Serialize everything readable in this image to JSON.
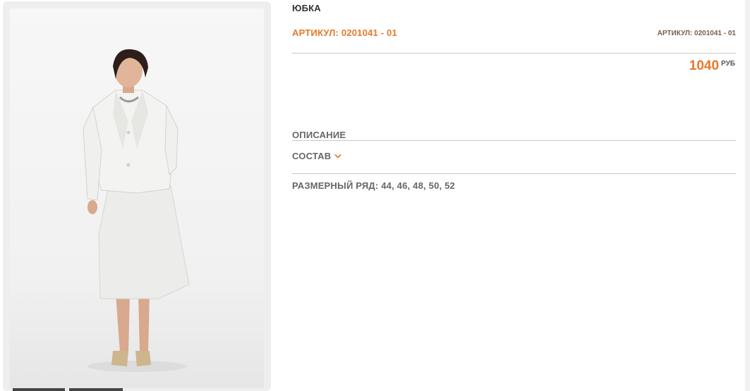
{
  "product": {
    "title": "ЮБКА",
    "sku_main": "АРТИКУЛ: 0201041 - 01",
    "sku_small": "АРТИКУЛ: 0201041 - 01",
    "price": "1040",
    "currency": "РУБ"
  },
  "sections": {
    "description": "ОПИСАНИЕ",
    "composition": "СОСТАВ",
    "sizes": "РАЗМЕРНЫЙ РЯД: 44, 46, 48, 50, 52"
  },
  "colors": {
    "accent": "#e8782b",
    "text": "#666666",
    "divider": "#c9c9c9"
  },
  "icons": {
    "composition_toggle": "chevron-down-icon"
  }
}
